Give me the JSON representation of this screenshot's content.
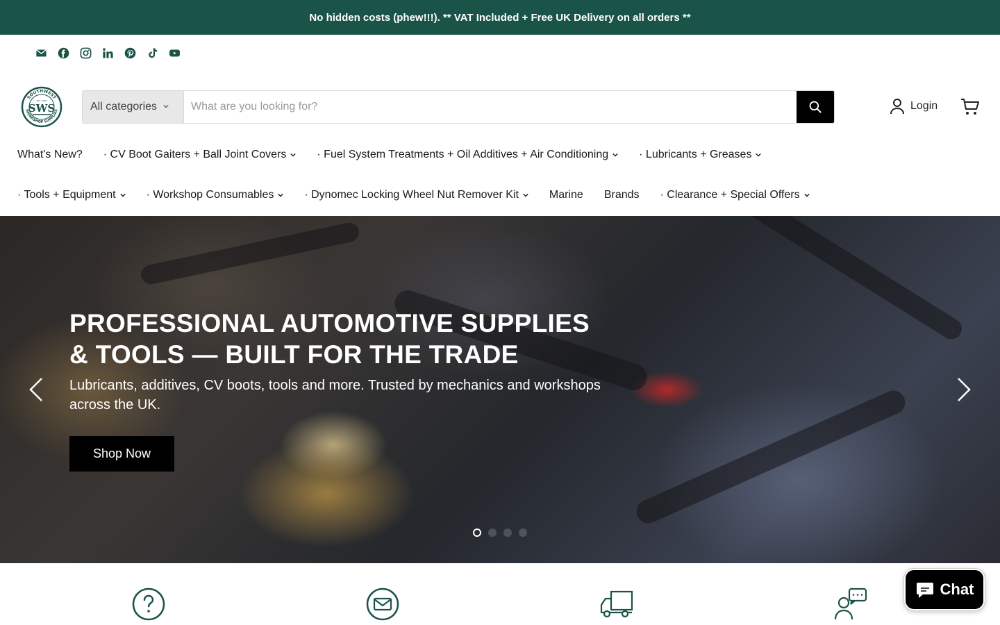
{
  "announcement": {
    "text": "No hidden costs (phew!!!). ** VAT Included + Free UK Delivery on all orders **"
  },
  "social_icons": [
    "email-icon",
    "facebook-icon",
    "instagram-icon",
    "linkedin-icon",
    "pinterest-icon",
    "tiktok-icon",
    "youtube-icon"
  ],
  "brand": {
    "logo_text_top": "SOUTHWEST",
    "logo_text_mid": "SWS",
    "logo_text_bottom": "WORKSHOP SUPPLIES",
    "logo_est": "EST. 1999",
    "color": "#1a5348"
  },
  "search": {
    "category_label": "All categories",
    "placeholder": "What are you looking for?"
  },
  "account": {
    "login_label": "Login"
  },
  "nav": {
    "row1": [
      {
        "label": "What's New?",
        "dropdown": false
      },
      {
        "label": "· CV Boot Gaiters + Ball Joint Covers",
        "dropdown": true
      },
      {
        "label": "· Fuel System Treatments + Oil Additives + Air Conditioning",
        "dropdown": true
      },
      {
        "label": "· Lubricants + Greases",
        "dropdown": true
      }
    ],
    "row2": [
      {
        "label": "· Tools + Equipment",
        "dropdown": true
      },
      {
        "label": "· Workshop Consumables",
        "dropdown": true
      },
      {
        "label": "· Dynomec Locking Wheel Nut Remover Kit",
        "dropdown": true
      },
      {
        "label": "Marine",
        "dropdown": false
      },
      {
        "label": "Brands",
        "dropdown": false
      },
      {
        "label": "· Clearance + Special Offers",
        "dropdown": true
      }
    ]
  },
  "hero": {
    "title_line1": "PROFESSIONAL AUTOMOTIVE SUPPLIES",
    "title_line2": "& TOOLS — BUILT FOR THE TRADE",
    "subtitle": "Lubricants, additives, CV boots, tools and more. Trusted by mechanics and workshops across the UK.",
    "cta_label": "Shop Now",
    "slides_total": 4,
    "active_slide": 1
  },
  "features": [
    "question-icon",
    "email-circle-icon",
    "delivery-truck-icon",
    "support-chat-icon"
  ],
  "chat_widget": {
    "label": "Chat"
  },
  "colors": {
    "accent": "#1a5348",
    "button": "#000000",
    "white": "#ffffff"
  }
}
